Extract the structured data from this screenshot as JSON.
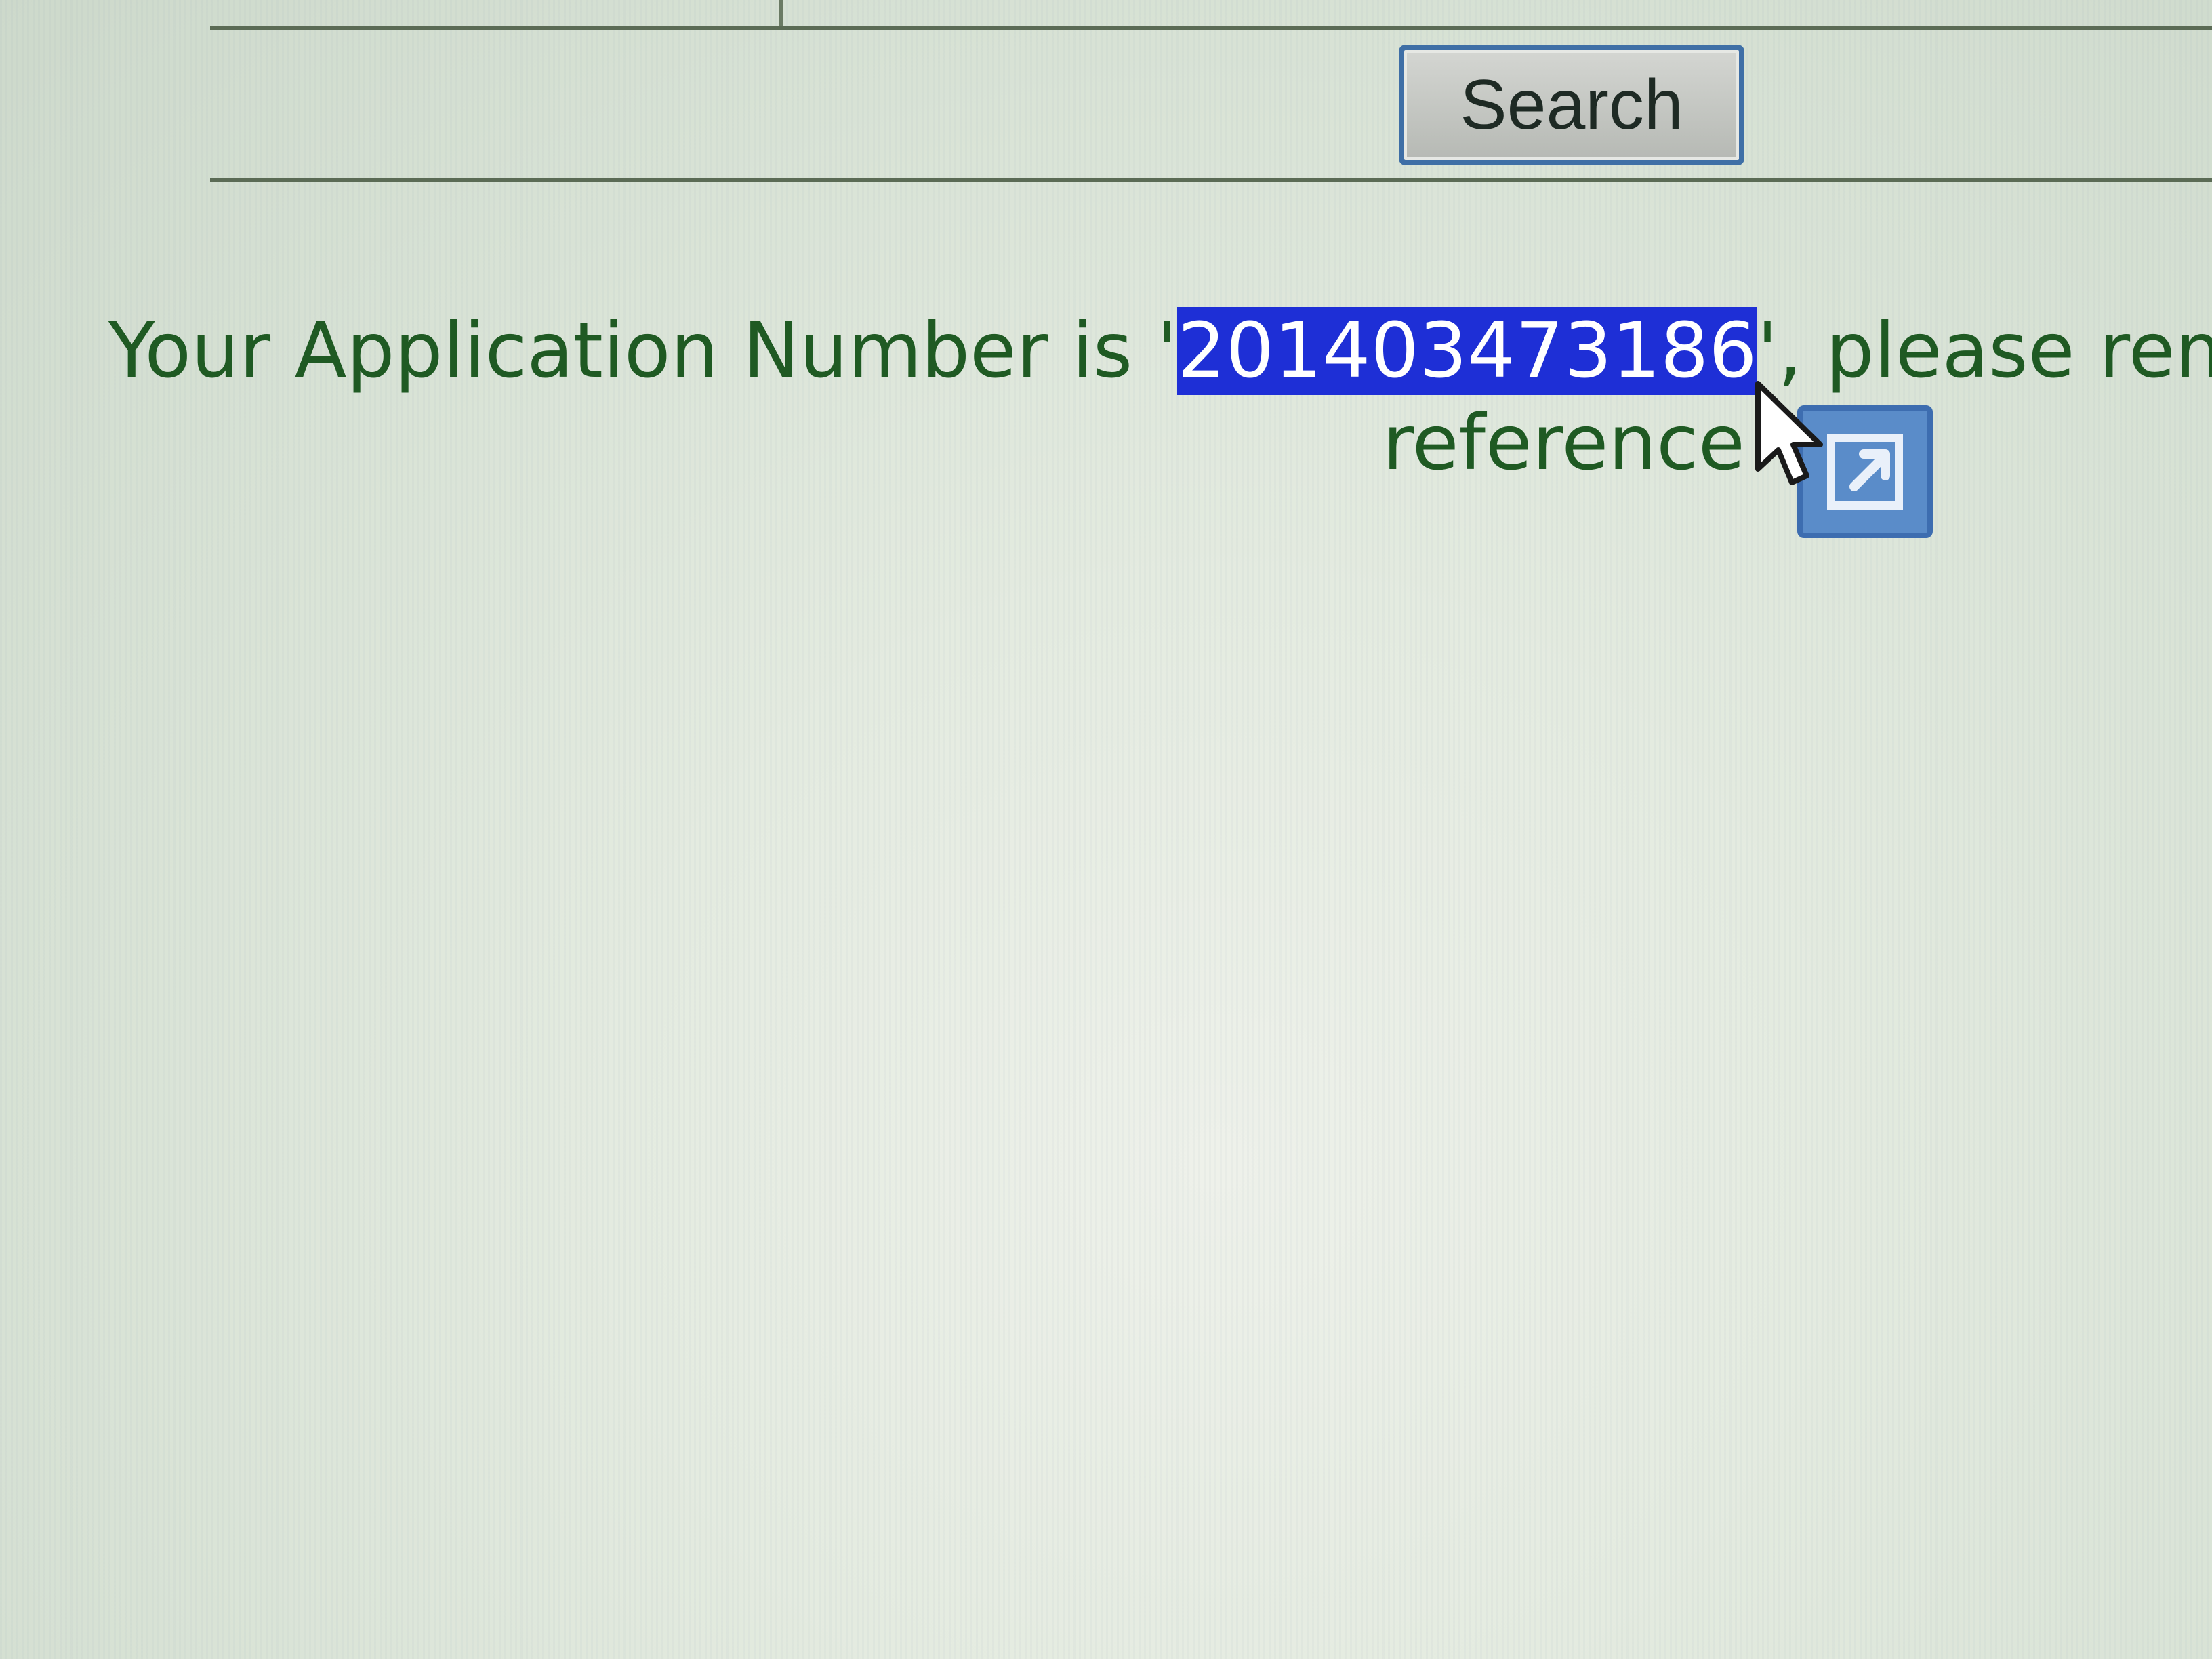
{
  "toolbar": {
    "search_label": "Search"
  },
  "confirmation": {
    "prefix": "Your Application Number is '",
    "application_number": "201403473186",
    "suffix": "', please rem",
    "line2": "reference"
  },
  "icons": {
    "popup": "open-in-new-icon",
    "cursor": "mouse-pointer-icon"
  },
  "colors": {
    "message_text": "#1f5a23",
    "selection_highlight": "#1e2fd6",
    "button_border": "#3f6fa6"
  }
}
